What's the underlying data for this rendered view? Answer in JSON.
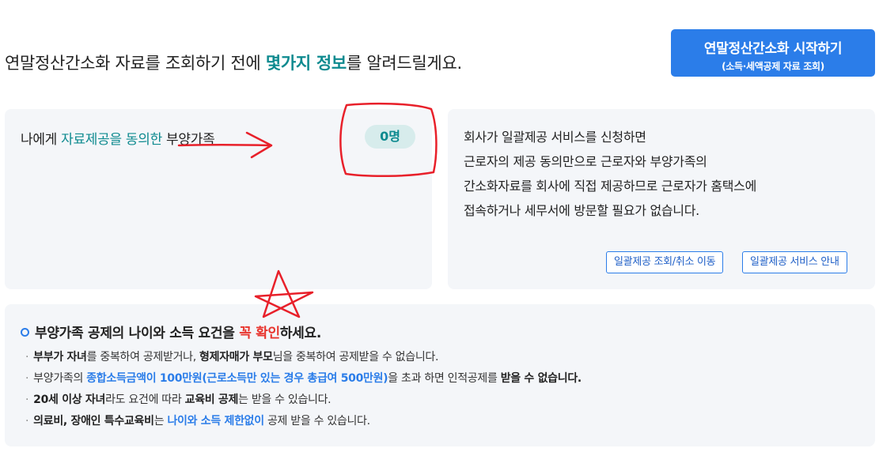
{
  "header": {
    "headline_pre": "연말정산간소화 자료를 조회하기 전에 ",
    "headline_highlight": "몇가지 정보",
    "headline_post": "를 알려드릴게요."
  },
  "start_button": {
    "label": "연말정산간소화 시작하기",
    "sublabel": "(소득·세액공제 자료 조회)"
  },
  "consent_panel": {
    "label_pre": "나에게 ",
    "label_highlight": "자료제공을 동의한",
    "label_post": " 부양가족",
    "count": "0명"
  },
  "info_panel": {
    "lines": [
      "회사가 일괄제공 서비스를 신청하면",
      "근로자의 제공 동의만으로 근로자와 부양가족의",
      "간소화자료를 회사에 직접 제공하므로 근로자가 홈택스에",
      "접속하거나 세무서에 방문할 필요가 없습니다."
    ],
    "buttons": [
      "일괄제공 조회/취소 이동",
      "일괄제공 서비스 안내"
    ]
  },
  "notice": {
    "title_pre": "부양가족 공제의 나이와 소득 요건을 ",
    "title_red": "꼭 확인",
    "title_post": "하세요.",
    "items": [
      {
        "b1": "부부가 자녀",
        "t1": "를 중복하여 공제받거나, ",
        "b2": "형제자매가 부모",
        "t2": "님을 중복하여 공제받을 수 없습니다."
      },
      {
        "t0": "부양가족의 ",
        "blue": "종합소득금액이 100만원(근로소득만 있는 경우 총급여 500만원)",
        "t1": "을 초과 하면 인적공제를 ",
        "b1": "받을 수 없습니다."
      },
      {
        "b1": "20세 이상 자녀",
        "t1": "라도 요건에 따라 ",
        "b2": "교육비 공제",
        "t2": "는 받을 수 있습니다."
      },
      {
        "b1": "의료비, 장애인 특수교육비",
        "t1": "는 ",
        "blue": "나이와 소득 제한없이",
        "t2": " 공제 받을 수 있습니다."
      }
    ]
  },
  "colors": {
    "teal": "#0d8a8f",
    "blue": "#2b7de9",
    "red": "#e8352e",
    "annotation_red": "#e8202a",
    "panel_bg": "#f4f6f9"
  }
}
